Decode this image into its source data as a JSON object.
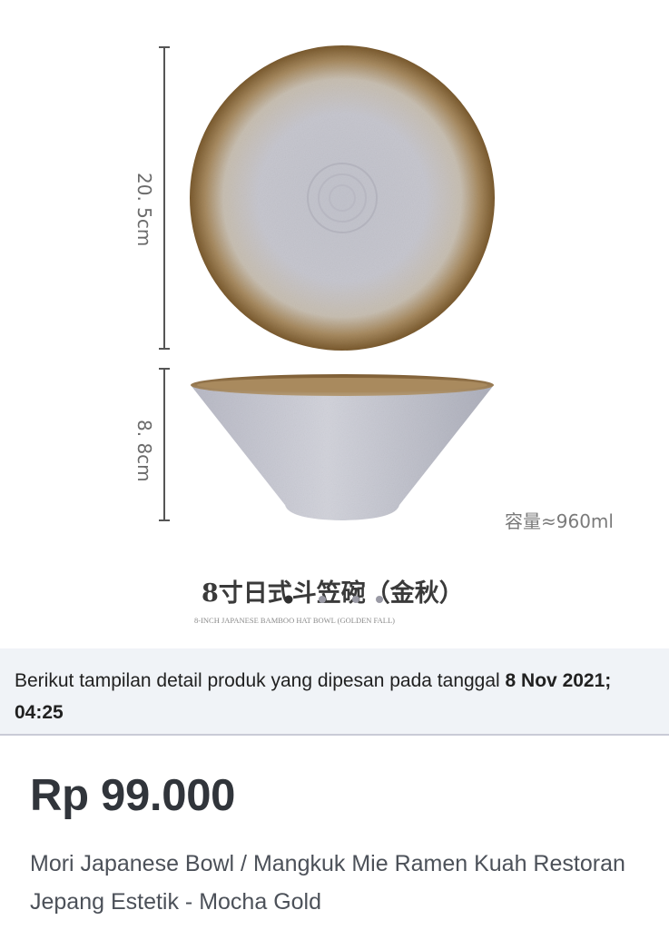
{
  "product_image": {
    "dim_height": "20. 5cm",
    "dim_bowl_height": "8. 8cm",
    "capacity": "容量≈960ml",
    "cn_title": "8寸日式斗笠碗（金秋）",
    "en_subtitle": "8-INCH JAPANESE BAMBOO HAT BOWL  (GOLDEN FALL)",
    "carousel_dots": 4
  },
  "order_info": {
    "prefix": "Berikut tampilan detail produk yang dipesan pada tanggal ",
    "date": "8 Nov 2021; 04:25"
  },
  "product": {
    "price": "Rp 99.000",
    "name": "Mori Japanese Bowl / Mangkuk Mie Ramen Kuah Restoran Jepang Estetik - Mocha Gold"
  },
  "colors": {
    "banner_bg": "#f0f3f7",
    "text_primary": "#31353b",
    "bowl_rim": "#8a6a3a",
    "bowl_glaze": "#c9c9d2"
  }
}
